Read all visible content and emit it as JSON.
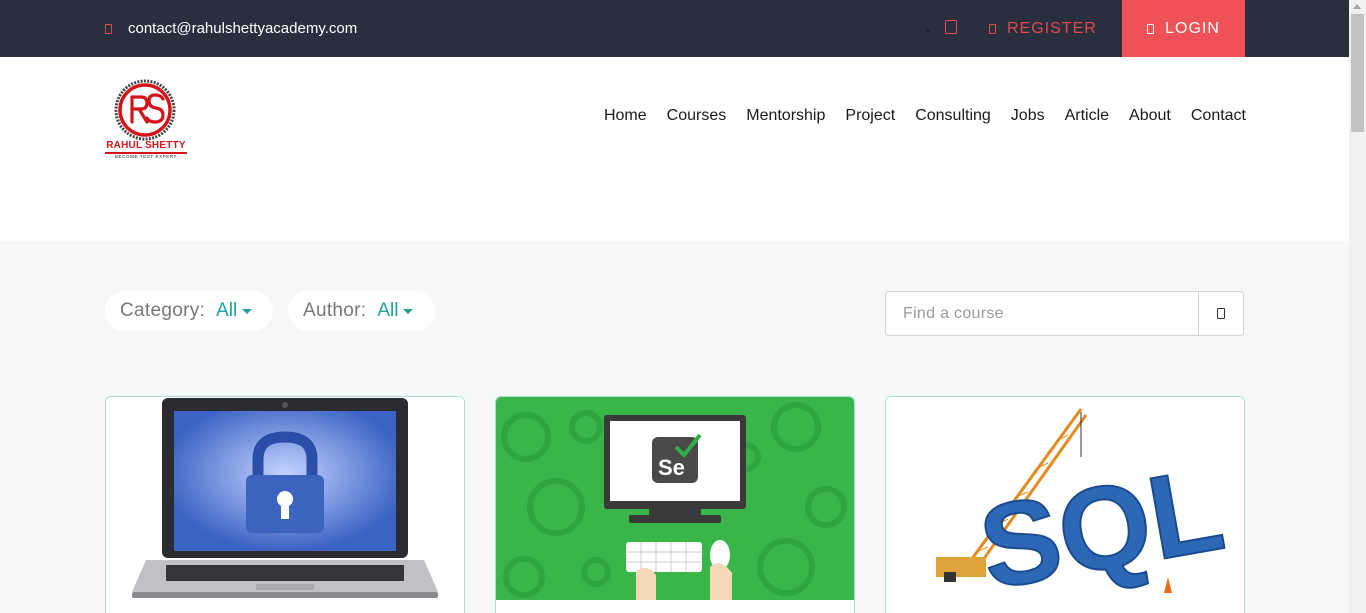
{
  "topbar": {
    "email": "contact@rahulshettyacademy.com",
    "register_label": "REGISTER",
    "login_label": "LOGIN"
  },
  "logo": {
    "initials": "RS",
    "name": "RAHUL SHETTY",
    "tagline": "BECOME TEST EXPERT"
  },
  "nav": {
    "items": [
      "Home",
      "Courses",
      "Mentorship",
      "Project",
      "Consulting",
      "Jobs",
      "Article",
      "About",
      "Contact"
    ]
  },
  "filters": {
    "category_label": "Category:",
    "category_value": "All",
    "author_label": "Author:",
    "author_value": "All"
  },
  "search": {
    "placeholder": "Find a course"
  },
  "cards": [
    {
      "image": "laptop-padlock-icon"
    },
    {
      "image": "selenium-computer-icon",
      "badge": "Se"
    },
    {
      "image": "sql-crane-icon",
      "text": "SQL"
    }
  ],
  "colors": {
    "topbar_bg": "#292f3d",
    "accent_red": "#ee5256",
    "teal": "#1fa098"
  }
}
